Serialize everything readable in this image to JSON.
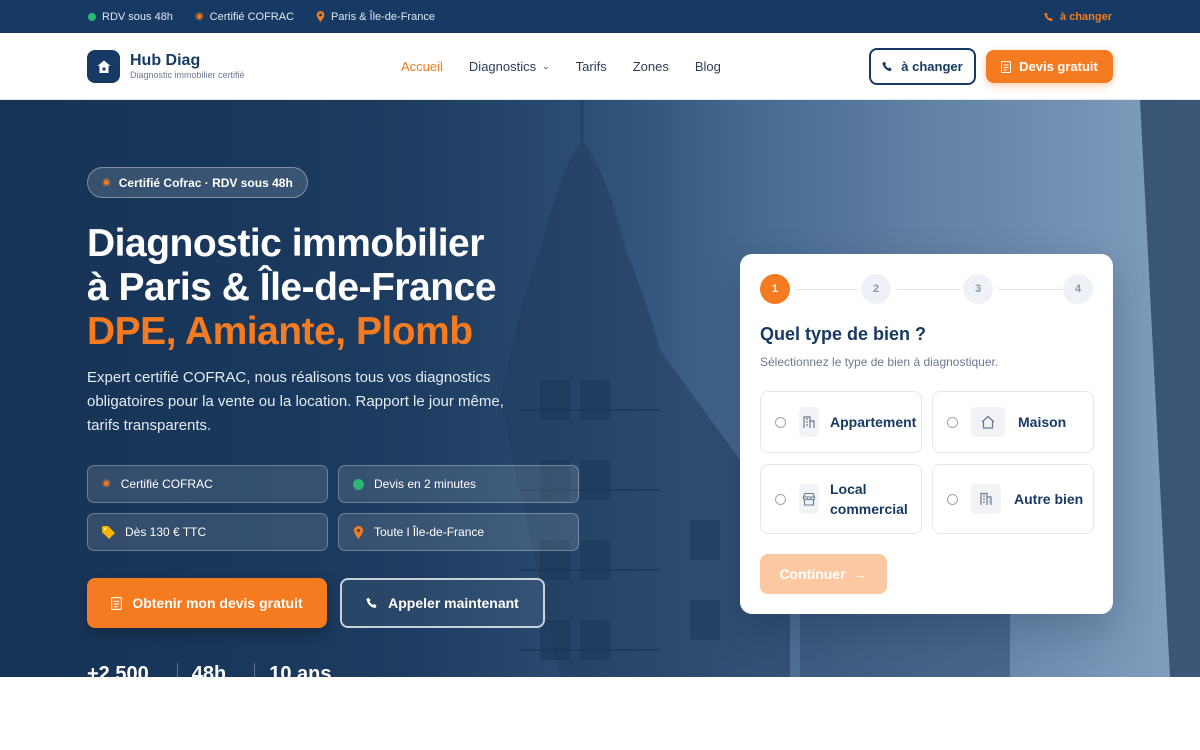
{
  "topbar": {
    "items": [
      "RDV sous 48h",
      "Certifié COFRAC",
      "Paris & Île-de-France"
    ],
    "phone_label": "à changer"
  },
  "brand": {
    "name": "Hub Diag",
    "tagline": "Diagnostic immobilier certifié"
  },
  "nav": {
    "items": [
      {
        "label": "Accueil",
        "active": true
      },
      {
        "label": "Diagnostics",
        "has_dropdown": true
      },
      {
        "label": "Tarifs"
      },
      {
        "label": "Zones"
      },
      {
        "label": "Blog"
      }
    ],
    "phone_button": "à changer",
    "quote_button": "Devis gratuit"
  },
  "hero": {
    "badge": "Certifié Cofrac · RDV sous 48h",
    "title_line1": "Diagnostic immobilier",
    "title_line2": "à Paris & Île-de-France",
    "title_accent": "DPE, Amiante, Plomb",
    "lead": "Expert certifié COFRAC, nous réalisons tous vos diagnostics obligatoires pour la vente ou la location. Rapport le jour même, tarifs transparents.",
    "features": [
      "Certifié COFRAC",
      "Devis en 2 minutes",
      "Dès 130 € TTC",
      "Toute l Île-de-France"
    ],
    "cta_primary": "Obtenir mon devis gratuit",
    "cta_secondary": "Appeler maintenant",
    "stats": [
      "+2 500",
      "48h",
      "10 ans"
    ]
  },
  "form": {
    "steps": [
      "1",
      "2",
      "3",
      "4"
    ],
    "active_step": 1,
    "title": "Quel type de bien ?",
    "subtitle": "Sélectionnez le type de bien à diagnostiquer.",
    "options": [
      {
        "label": "Appartement",
        "icon": "building-icon"
      },
      {
        "label": "Maison",
        "icon": "house-icon"
      },
      {
        "label": "Local commercial",
        "icon": "shop-icon"
      },
      {
        "label": "Autre bien",
        "icon": "office-icon"
      }
    ],
    "next_button": "Continuer"
  },
  "colors": {
    "navy": "#163a63",
    "orange": "#f47b20",
    "green": "#2bb673"
  }
}
